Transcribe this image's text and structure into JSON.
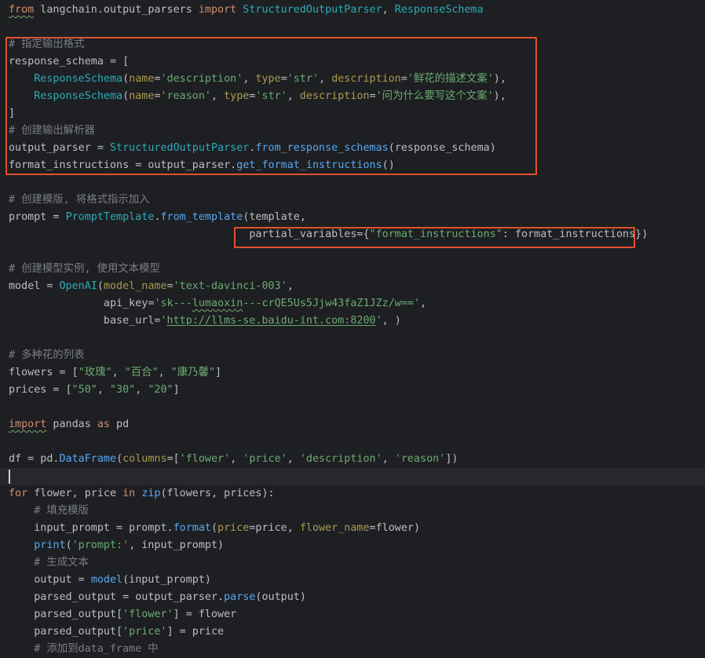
{
  "editor": {
    "language": "python",
    "theme_colors": {
      "background": "#1e1f22",
      "keyword": "#cf8e6d",
      "string": "#6aab73",
      "comment": "#7a7e85",
      "function": "#56a8f5",
      "class": "#2aacb8",
      "param": "#aa9b51",
      "highlight_box": "#e2502e"
    },
    "lines": [
      "from langchain.output_parsers import StructuredOutputParser, ResponseSchema",
      "",
      "# 指定输出格式",
      "response_schema = [",
      "    ResponseSchema(name='description', type='str', description='鲜花的描述文案'),",
      "    ResponseSchema(name='reason', type='str', description='问为什么要写这个文案'),",
      "]",
      "# 创建输出解析器",
      "output_parser = StructuredOutputParser.from_response_schemas(response_schema)",
      "format_instructions = output_parser.get_format_instructions()",
      "",
      "# 创建模版, 将格式指示加入",
      "prompt = PromptTemplate.from_template(template,",
      "                                      partial_variables={\"format_instructions\": format_instructions})",
      "",
      "# 创建模型实例, 使用文本模型",
      "model = OpenAI(model_name='text-davinci-003',",
      "               api_key='sk---lumaoxin---crQE5Us5Jjw43faZ1JZz/w==',",
      "               base_url='http://llms-se.baidu-int.com:8200', )",
      "",
      "# 多种花的列表",
      "flowers = [\"玫瑰\", \"百合\", \"康乃馨\"]",
      "prices = [\"50\", \"30\", \"20\"]",
      "",
      "import pandas as pd",
      "",
      "df = pd.DataFrame(columns=['flower', 'price', 'description', 'reason'])",
      "",
      "for flower, price in zip(flowers, prices):",
      "    # 填充模版",
      "    input_prompt = prompt.format(price=price, flower_name=flower)",
      "    print('prompt:', input_prompt)",
      "    # 生成文本",
      "    output = model(input_prompt)",
      "    parsed_output = output_parser.parse(output)",
      "    parsed_output['flower'] = flower",
      "    parsed_output['price'] = price",
      "    # 添加到data_frame 中"
    ],
    "caret_line": 28
  }
}
